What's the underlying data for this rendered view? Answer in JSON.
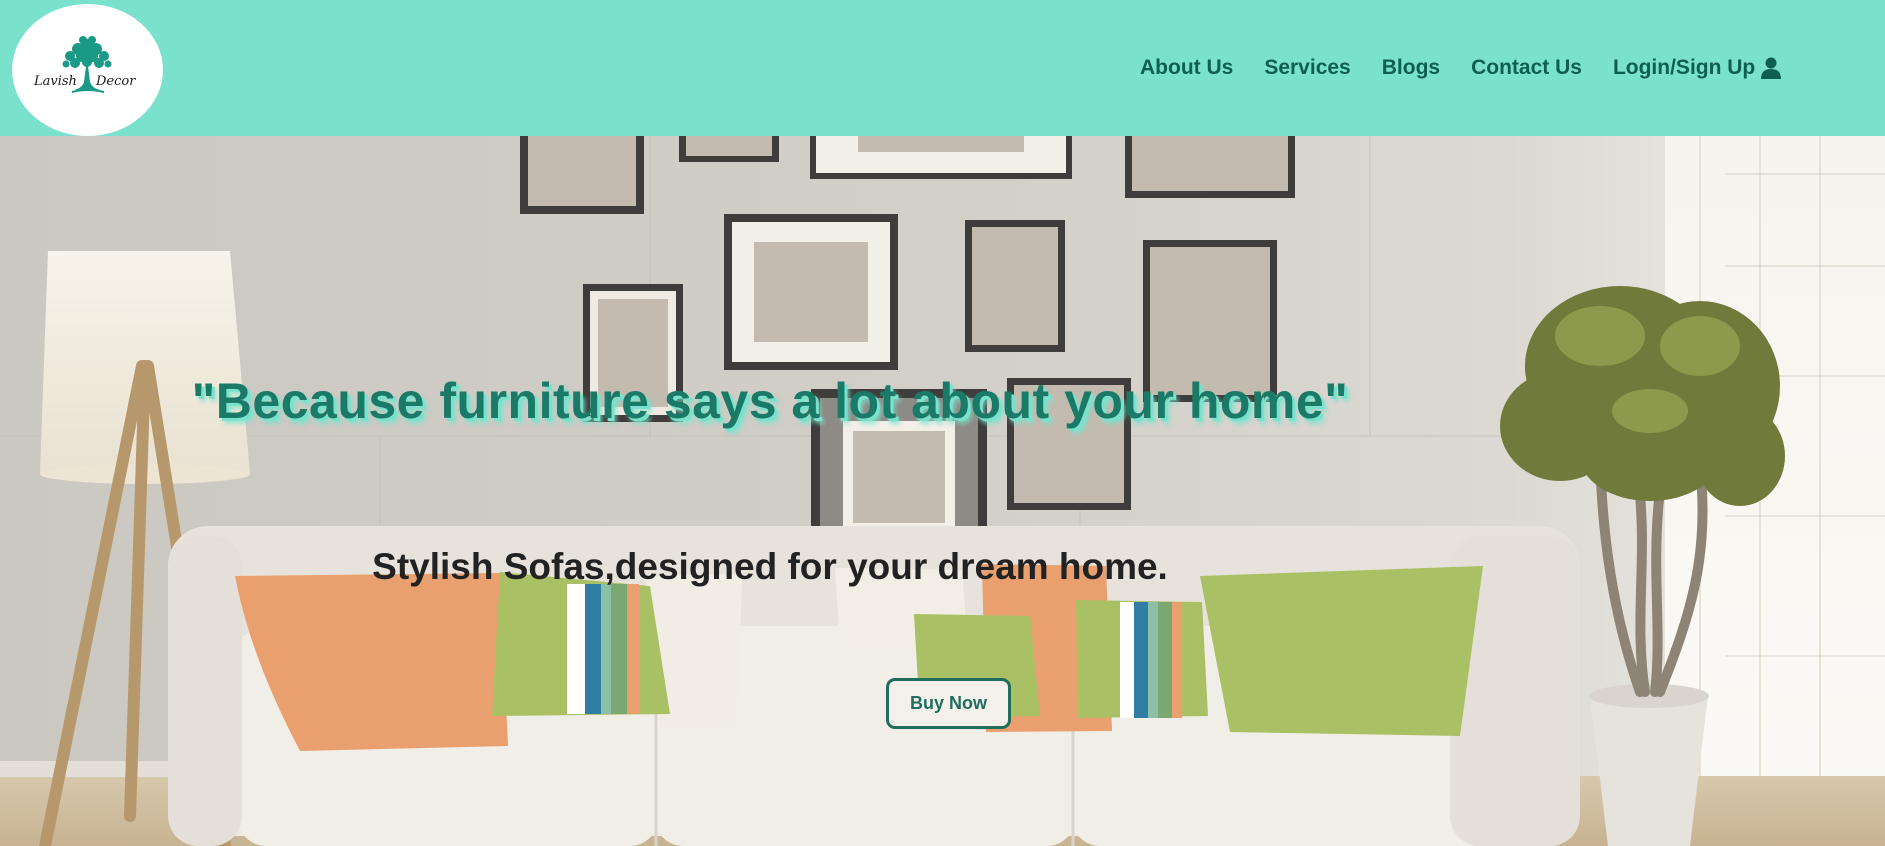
{
  "brand": {
    "logo_text_left": "Lavish",
    "logo_text_right": "Decor",
    "logo_icon": "tree-icon",
    "accent": "#7ae2cc",
    "primary_text": "#0f5f51"
  },
  "nav": {
    "items": [
      {
        "label": "About Us"
      },
      {
        "label": "Services"
      },
      {
        "label": "Blogs"
      },
      {
        "label": "Contact Us"
      },
      {
        "label": "Login/Sign Up",
        "icon": "user-icon"
      }
    ]
  },
  "hero": {
    "headline": "\"Because furniture says a lot about your home\"",
    "tagline": "Stylish Sofas,designed for your dream home.",
    "cta_label": "Buy Now"
  }
}
